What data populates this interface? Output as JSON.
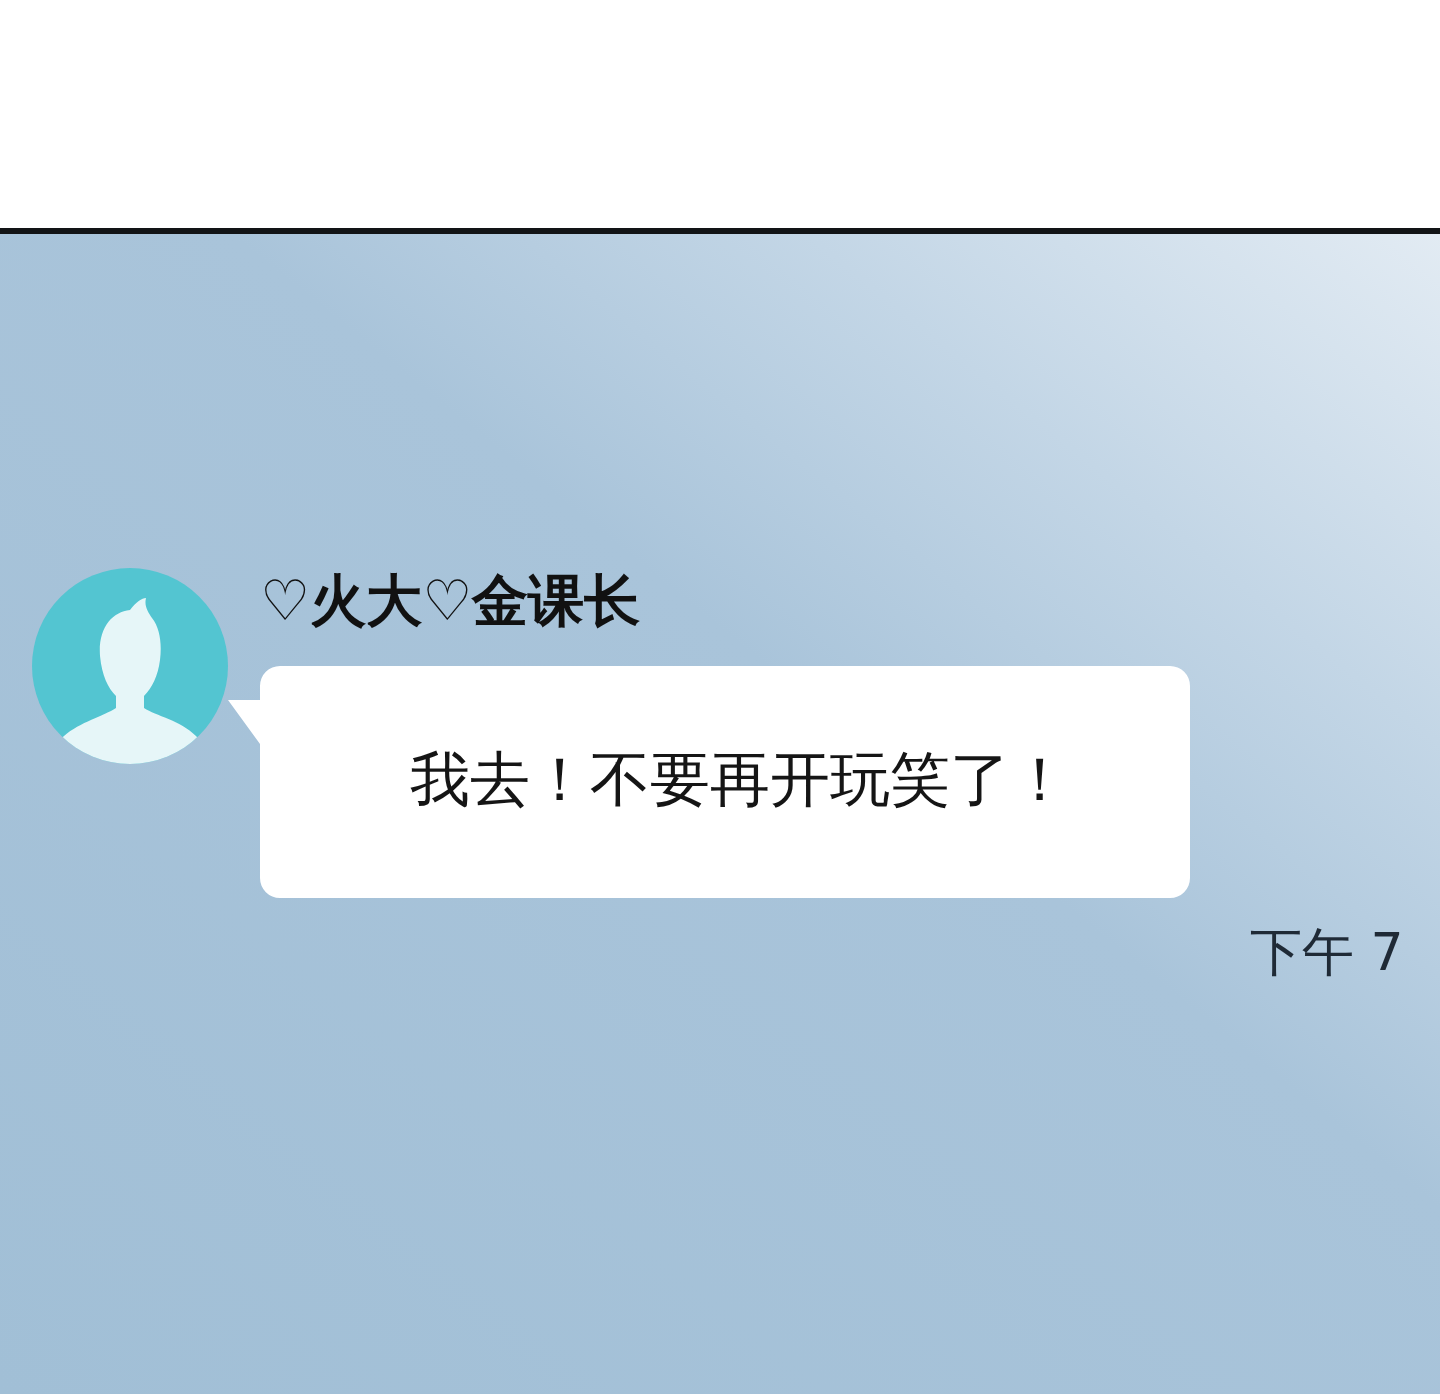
{
  "messages": [
    {
      "sender": "♡火大♡金课长",
      "text": "我去！不要再开玩笑了！",
      "time": "下午 7"
    }
  ]
}
